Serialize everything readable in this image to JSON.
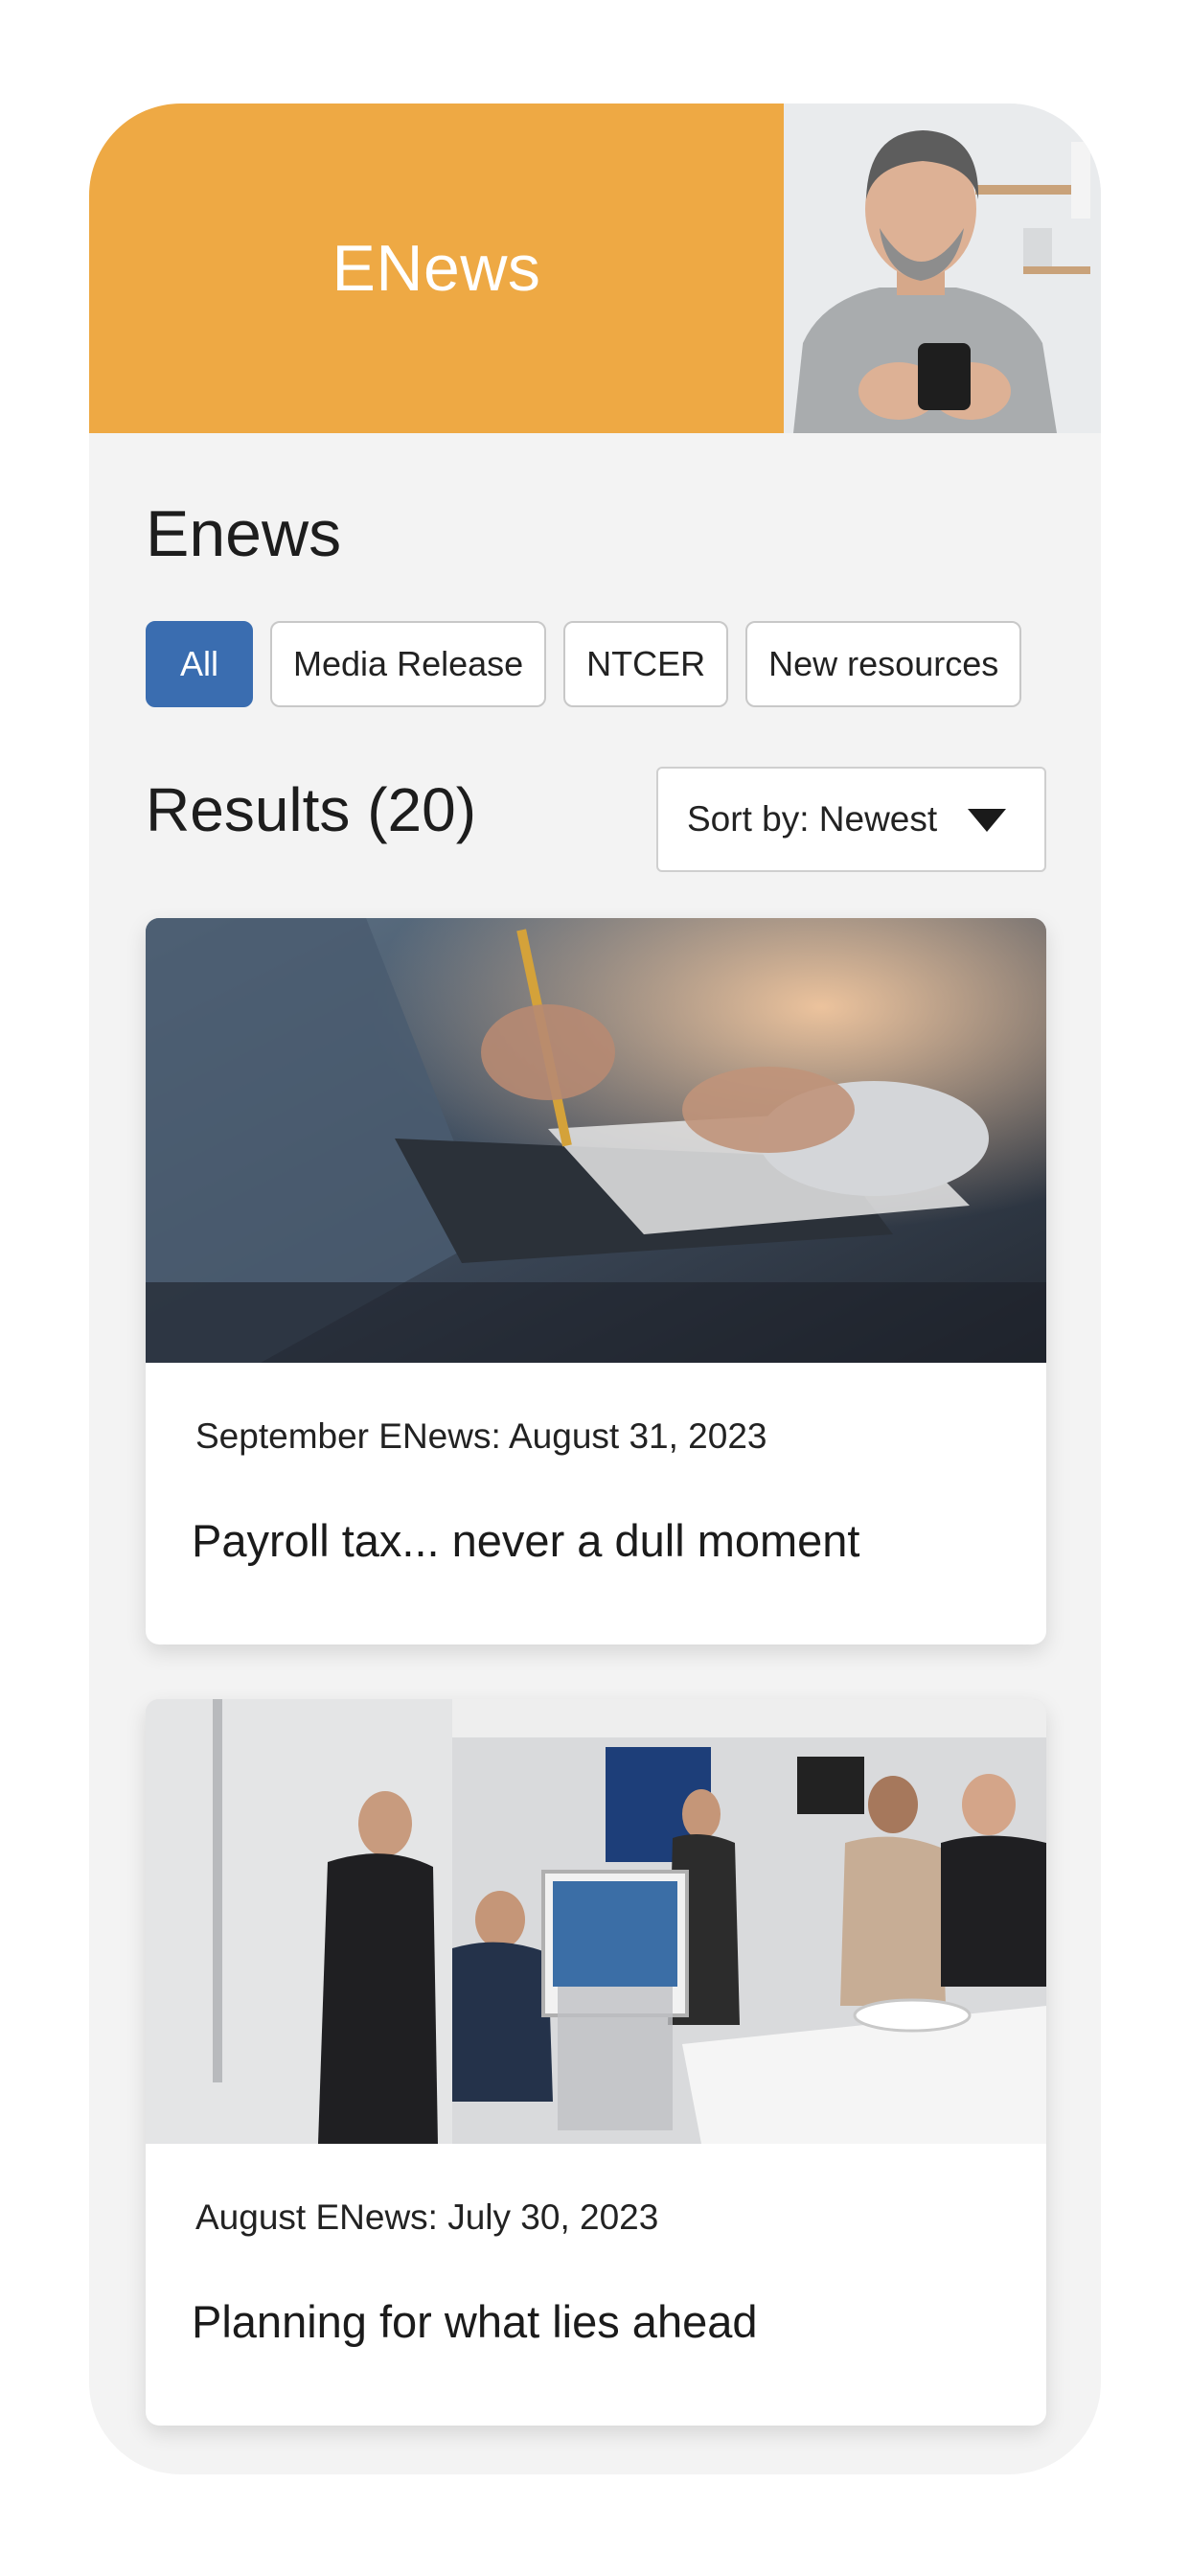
{
  "hero": {
    "title": "ENews"
  },
  "section": {
    "heading": "Enews"
  },
  "filters": {
    "items": [
      {
        "label": "All",
        "active": true
      },
      {
        "label": "Media Release",
        "active": false
      },
      {
        "label": "NTCER",
        "active": false
      },
      {
        "label": "New resources",
        "active": false
      }
    ]
  },
  "results": {
    "title": "Results (20)",
    "sort_label": "Sort by: Newest"
  },
  "articles": [
    {
      "meta": "September ENews: August 31, 2023",
      "title": "Payroll tax... never a dull moment"
    },
    {
      "meta": "August ENews: July 30, 2023",
      "title": "Planning for what lies ahead"
    }
  ],
  "colors": {
    "hero_bg": "#eea944",
    "active_tab": "#3a6db0",
    "page_bg": "#f3f3f3"
  }
}
